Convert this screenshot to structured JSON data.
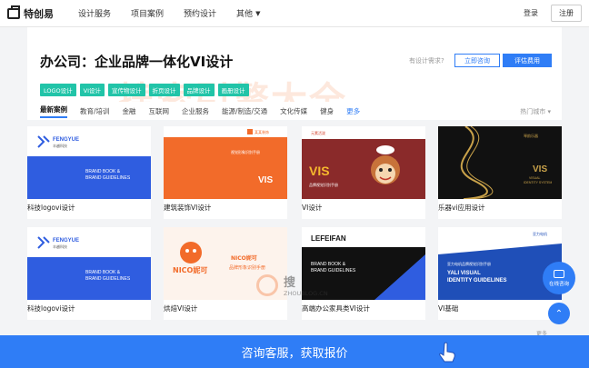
{
  "brand": {
    "name": "特创易"
  },
  "nav": [
    {
      "label": "设计服务"
    },
    {
      "label": "项目案例"
    },
    {
      "label": "预约设计"
    },
    {
      "label": "其他"
    }
  ],
  "auth": {
    "login": "登录",
    "register": "注册"
  },
  "header": {
    "title": "办公司：企业品牌一体化VI设计",
    "need_text": "有设计需求?",
    "consult_button": "立即咨询",
    "quote_button": "评估费用",
    "watermark": "搜索引擎大全"
  },
  "tags": [
    "LOGO设计",
    "VI设计",
    "宣传物设计",
    "折页设计",
    "品牌设计",
    "画册设计"
  ],
  "categories": [
    {
      "label": "最新案例",
      "active": true
    },
    {
      "label": "教育/培训"
    },
    {
      "label": "金融"
    },
    {
      "label": "互联网"
    },
    {
      "label": "企业服务"
    },
    {
      "label": "能源/制造/交通"
    },
    {
      "label": "文化传媒"
    },
    {
      "label": "健身"
    },
    {
      "label": "更多"
    }
  ],
  "hot_city": "热门城市",
  "cards": [
    {
      "caption": "科技logovi设计",
      "brand_name": "FENGYUE",
      "brand_sub": "丰越科技",
      "line1": "BRAND BOOK &",
      "line2": "BRAND GUIDELINES"
    },
    {
      "caption": "建筑装饰VI设计",
      "brand_name": "某某装饰",
      "label": "视觉形象识别手册",
      "vis": "VIS"
    },
    {
      "caption": "VI设计",
      "brand_name": "元素活泼",
      "vis": "VIS",
      "label": "品牌视觉识别手册"
    },
    {
      "caption": "乐器vi应用设计",
      "brand_name": "琴韵乐器",
      "vis": "VIS",
      "line1": "VISUAL",
      "line2": "IDENTITY SYSTEM"
    },
    {
      "caption": "科技logovi设计",
      "brand_name": "FENGYUE",
      "brand_sub": "丰越科技",
      "line1": "BRAND BOOK &",
      "line2": "BRAND GUIDELINES"
    },
    {
      "caption": "烘焙VI设计",
      "brand_name": "NICO妮可",
      "line1": "NICO妮可",
      "line2": "品牌形象识别手册"
    },
    {
      "caption": "高端办公家具类VI设计",
      "brand_name": "LEFEIFAN",
      "line1": "BRAND BOOK &",
      "line2": "BRAND GUIDELINES"
    },
    {
      "caption": "VI基础",
      "brand_name": "亚力电机",
      "line1": "亚力电机品牌视觉识别手册",
      "line2": "YALI VISUAL",
      "line3": "IDENTITY GUIDELINES"
    }
  ],
  "float_chat": "在线咨询",
  "float_more": "更多",
  "bottom_bar": "咨询客服，获取报价",
  "center_watermark": {
    "cn": "搜",
    "en": "ZHOUBLOG.CN"
  },
  "colors": {
    "primary": "#2f7df6",
    "tag": "#21c4a8",
    "orange": "#f26b2a"
  }
}
